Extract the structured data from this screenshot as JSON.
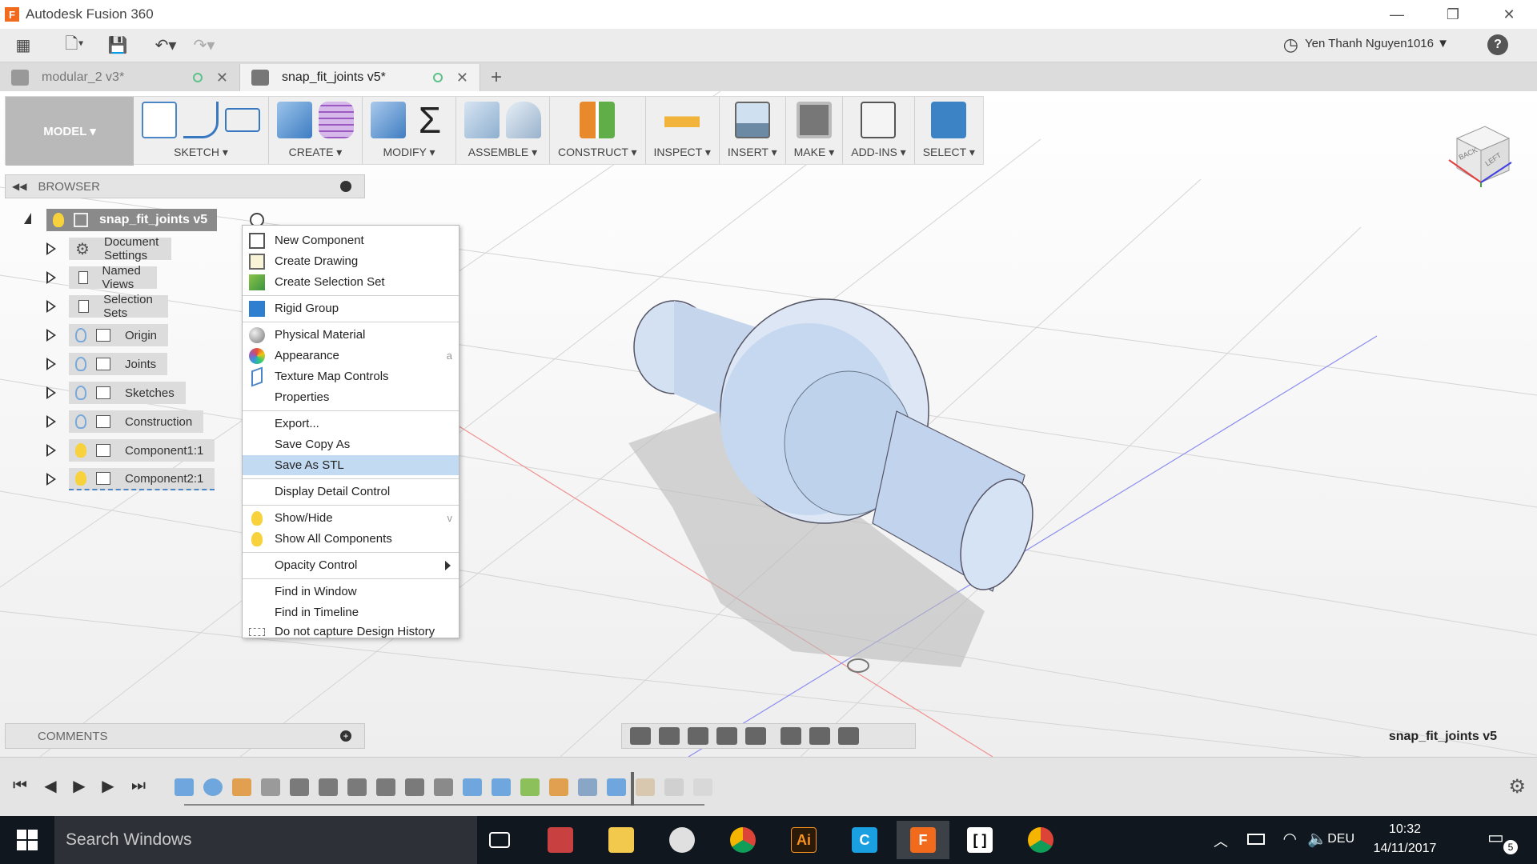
{
  "window": {
    "title": "Autodesk Fusion 360"
  },
  "user": {
    "name": "Yen Thanh Nguyen1016 ▼"
  },
  "tabs": [
    {
      "label": "modular_2 v3*"
    },
    {
      "label": "snap_fit_joints v5*"
    }
  ],
  "toolbar": {
    "mode": "MODEL ▾",
    "groups": [
      {
        "label": "SKETCH ▾"
      },
      {
        "label": "CREATE ▾"
      },
      {
        "label": "MODIFY ▾"
      },
      {
        "label": "ASSEMBLE ▾"
      },
      {
        "label": "CONSTRUCT ▾"
      },
      {
        "label": "INSPECT ▾"
      },
      {
        "label": "INSERT ▾"
      },
      {
        "label": "MAKE ▾"
      },
      {
        "label": "ADD-INS ▾"
      },
      {
        "label": "SELECT ▾"
      }
    ]
  },
  "browser": {
    "title": "BROWSER",
    "root": "snap_fit_joints v5",
    "items": [
      {
        "label": "Document Settings"
      },
      {
        "label": "Named Views"
      },
      {
        "label": "Selection Sets"
      },
      {
        "label": "Origin"
      },
      {
        "label": "Joints"
      },
      {
        "label": "Sketches"
      },
      {
        "label": "Construction"
      },
      {
        "label": "Component1:1"
      },
      {
        "label": "Component2:1"
      }
    ]
  },
  "context_menu": {
    "items": [
      {
        "label": "New Component"
      },
      {
        "label": "Create Drawing"
      },
      {
        "label": "Create Selection Set"
      },
      {
        "label": "Rigid Group"
      },
      {
        "label": "Physical Material"
      },
      {
        "label": "Appearance",
        "shortcut": "a"
      },
      {
        "label": "Texture Map Controls"
      },
      {
        "label": "Properties"
      },
      {
        "label": "Export..."
      },
      {
        "label": "Save Copy As"
      },
      {
        "label": "Save As STL",
        "highlighted": true
      },
      {
        "label": "Display Detail Control"
      },
      {
        "label": "Show/Hide",
        "shortcut": "v"
      },
      {
        "label": "Show All Components"
      },
      {
        "label": "Opacity Control"
      },
      {
        "label": "Find in Window"
      },
      {
        "label": "Find in Timeline"
      },
      {
        "label": "Do not capture Design History"
      }
    ]
  },
  "comments": {
    "title": "COMMENTS"
  },
  "viewport": {
    "document_name": "snap_fit_joints v5"
  },
  "viewcube": {
    "faces": [
      "BACK",
      "LEFT"
    ]
  },
  "taskbar": {
    "search_placeholder": "Search Windows",
    "language": "DEU",
    "time": "10:32",
    "date": "14/11/2017",
    "notifications": "5"
  },
  "colors": {
    "accent": "#3c83c6",
    "highlight": "#c3dbf2",
    "part": "#c9daf0"
  }
}
